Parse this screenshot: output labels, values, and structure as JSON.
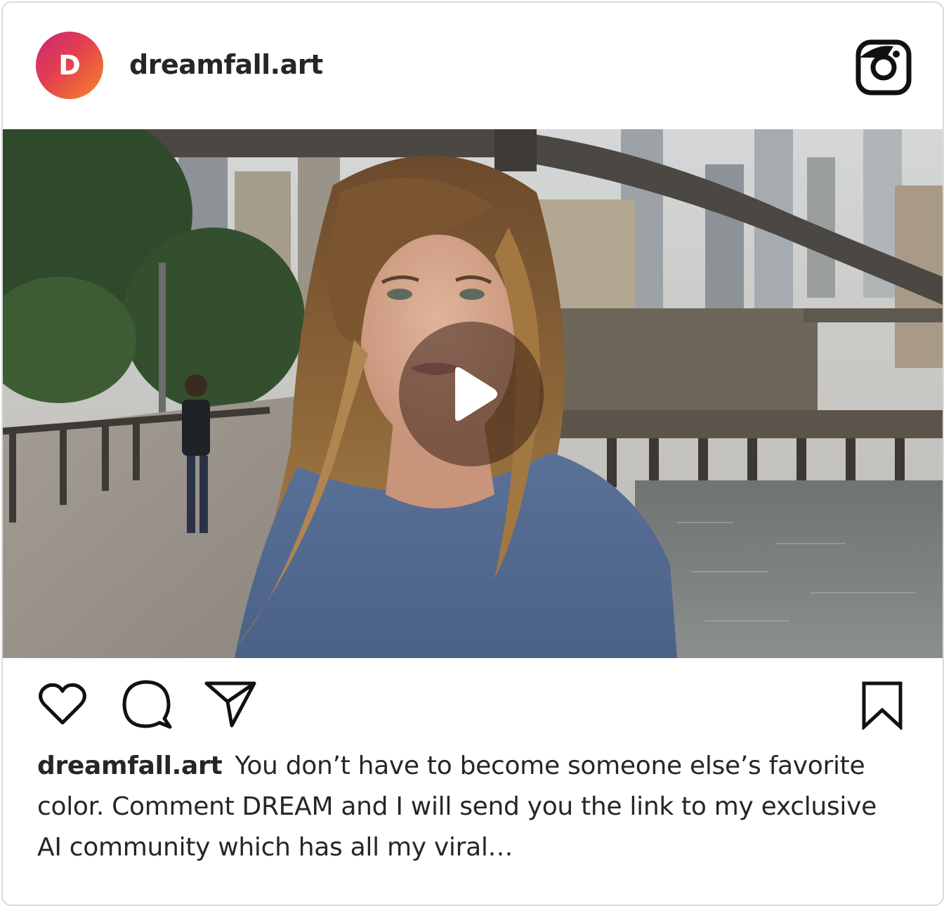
{
  "post": {
    "avatar_letter": "D",
    "username": "dreamfall.art",
    "caption_user": "dreamfall.art",
    "caption_text": "You don’t have to become someone else’s favorite color. Comment DREAM and I will send you the link to my exclusive AI community which has all my viral…"
  },
  "icons": {
    "header": "instagram-icon",
    "media": "play-icon",
    "actions": [
      "heart-icon",
      "comment-icon",
      "share-icon",
      "bookmark-icon"
    ]
  },
  "colors": {
    "avatar_gradient": [
      "#c7267a",
      "#e4404e",
      "#f5862b"
    ],
    "text": "#262626",
    "border": "#dbdbdb"
  }
}
